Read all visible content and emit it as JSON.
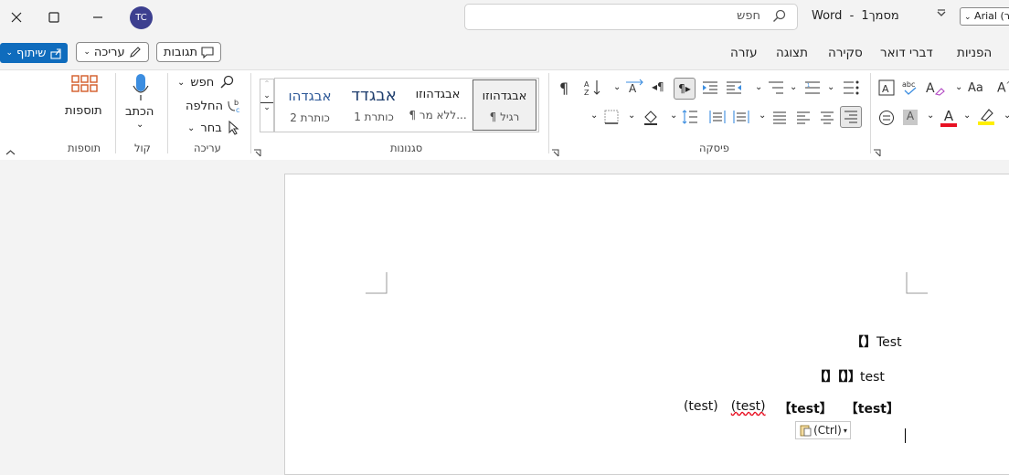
{
  "titlebar": {
    "avatar_initials": "TC",
    "search_placeholder": "חפש",
    "doc_name": "מסמך1",
    "app_name": "Word",
    "title_separator": "-",
    "font_name": "Arial (ר",
    "window_controls": [
      "close",
      "maximize",
      "minimize"
    ]
  },
  "menu": {
    "share_label": "שיתוף",
    "editing_label": "עריכה",
    "comments_label": "תגובות",
    "tabs": [
      "הפניות",
      "דברי דואר",
      "סקירה",
      "תצוגה",
      "עזרה"
    ]
  },
  "ribbon": {
    "groups": {
      "addins": "תוספות",
      "voice": "קול",
      "editing": "עריכה",
      "styles": "סגנונות",
      "paragraph": "פיסקה"
    },
    "addins_button": "תוספות",
    "dictate_button": "הכתב",
    "find_button": "חפש",
    "replace_button": "החלפה",
    "select_button": "בחר",
    "styles": [
      {
        "preview": "אבגדהוזו",
        "name": "¶ רגיל"
      },
      {
        "preview": "אבגדהוזו",
        "name": "¶ ללא מר..."
      },
      {
        "preview": "אבגדד",
        "name": "כותרת 1"
      },
      {
        "preview": "אבגדהו",
        "name": "כותרת 2"
      }
    ],
    "font_size_icon": "Aa",
    "font_color_letter": "A",
    "colors": {
      "accent": "#0f6cbd",
      "font_color": "#e81123",
      "highlight": "#ffef00",
      "avatar": "#3c3f8f"
    }
  },
  "document": {
    "line1": {
      "text": "Test",
      "brackets": "【】"
    },
    "line2": {
      "text": "test",
      "brackets": "【【】【】"
    },
    "line3": {
      "parts": [
        "【test】",
        "【test】",
        "(test)",
        "(test)"
      ]
    },
    "paste_options_label": "(Ctrl)"
  }
}
